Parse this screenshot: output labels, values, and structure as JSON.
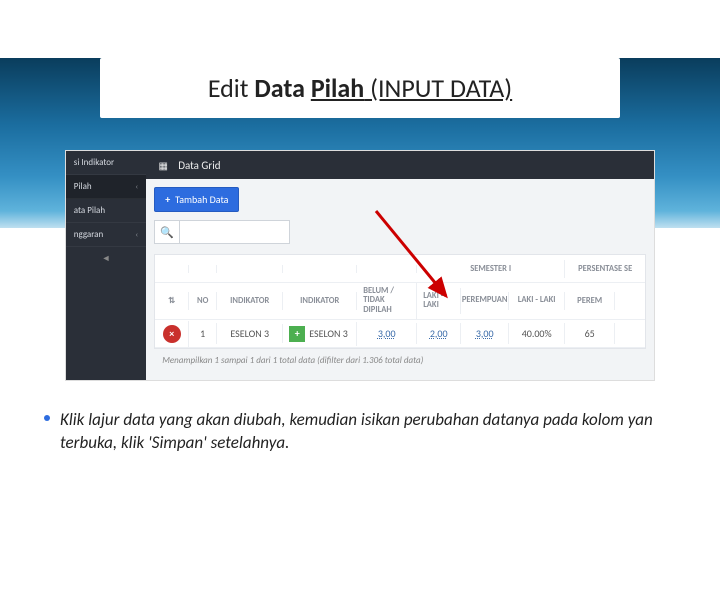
{
  "title": {
    "part1": "Edit ",
    "part2": "Data ",
    "part3": "Pilah",
    "part4": " (INPUT DATA)"
  },
  "sidebar": {
    "items": [
      {
        "label": "si Indikator"
      },
      {
        "label": "Pilah"
      },
      {
        "label": "ata Pilah"
      },
      {
        "label": "nggaran"
      }
    ]
  },
  "panel": {
    "tab_label": "Data Grid",
    "tambah_label": "Tambah Data"
  },
  "grid": {
    "group_headers": {
      "semester1": "SEMESTER I",
      "persentase": "PERSENTASE SE"
    },
    "headers": {
      "no": "NO",
      "indikator1": "INDIKATOR",
      "indikator2": "INDIKATOR",
      "belum": "BELUM / TIDAK DIPILAH",
      "laki1": "LAKI - LAKI",
      "perempuan1": "PEREMPUAN",
      "laki2": "LAKI - LAKI",
      "perem2": "PEREM"
    },
    "row": {
      "no": "1",
      "ind1": "ESELON 3",
      "ind2": "ESELON 3",
      "belum": "3,00",
      "laki1": "2,00",
      "perem1": "3,00",
      "laki2": "40.00%",
      "perem2": "65"
    },
    "footer": "Menampilkan 1 sampai 1 dari 1 total data (difilter dari 1.306 total data)"
  },
  "caption": "Klik lajur data yang akan diubah, kemudian isikan perubahan datanya pada kolom yan terbuka, klik 'Simpan' setelahnya."
}
